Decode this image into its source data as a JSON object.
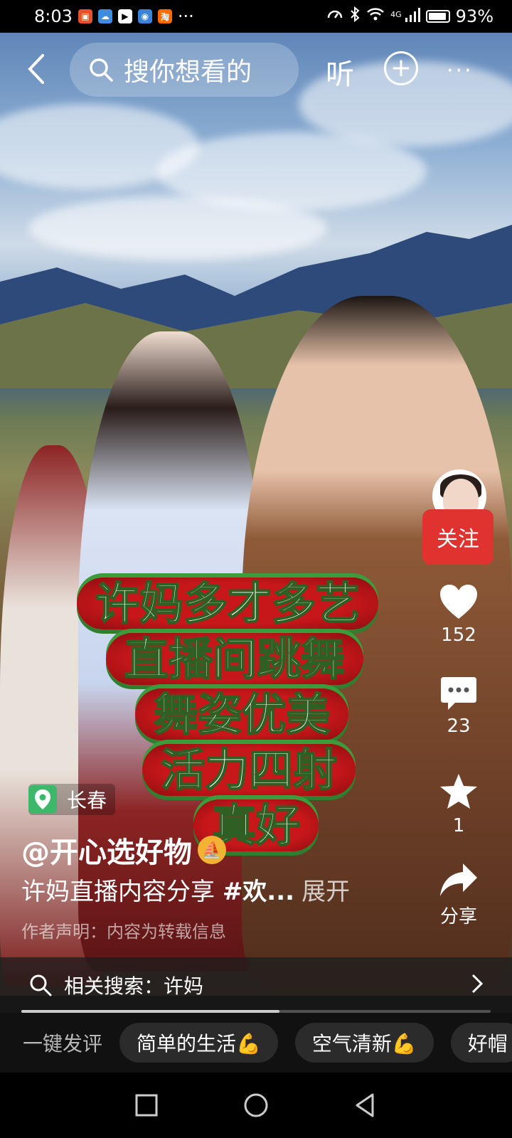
{
  "status_bar": {
    "time": "8:03",
    "ellipsis": "···",
    "notif_taobao": "淘",
    "signal_label": "4G",
    "battery_percent": "93%",
    "battery_level": 0.93
  },
  "top_bar": {
    "search_placeholder": "搜你想看的",
    "listen_label": "听",
    "add_label": "+",
    "more_label": "···"
  },
  "caption_lines": [
    "许妈多才多艺",
    "直播间跳舞",
    "舞姿优美",
    "活力四射",
    "真好"
  ],
  "location": {
    "city": "长春"
  },
  "author": {
    "handle": "@开心选好物"
  },
  "description": {
    "text": "许妈直播内容分享 ",
    "tag": "#欢...",
    "expand_label": "展开"
  },
  "disclaimer": "作者声明：内容为转载信息",
  "right_rail": {
    "follow_label": "关注",
    "like_count": "152",
    "comment_count": "23",
    "favorite_count": "1",
    "share_label": "分享"
  },
  "related_search": {
    "label": "相关搜索：许妈"
  },
  "video_progress": 0.55,
  "quick_comment": {
    "label": "一键发评",
    "chips": [
      "简单的生活💪",
      "空气清新💪",
      "好帽"
    ]
  },
  "colors": {
    "follow_red": "#e0322f",
    "location_green": "#3db86b",
    "badge_gold": "#f3b233"
  }
}
